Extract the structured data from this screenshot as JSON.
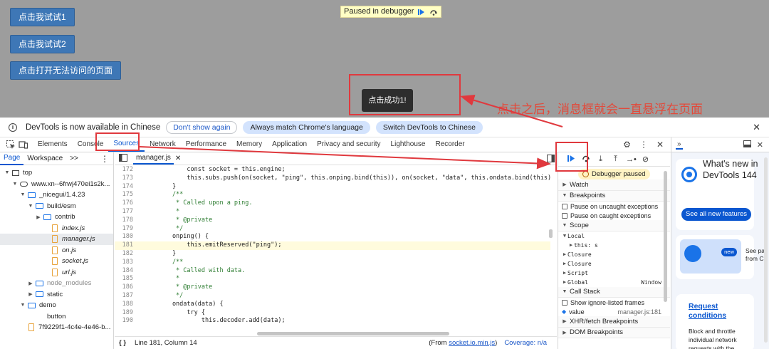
{
  "page": {
    "buttons": [
      "点击我试试1",
      "点击我试试2",
      "点击打开无法访问的页面"
    ],
    "paused_banner": "Paused in debugger",
    "toast": "点击成功1!",
    "annotation": "点击之后，消息框就会一直悬浮在页面"
  },
  "infobar": {
    "message": "DevTools is now available in Chinese",
    "dont_show": "Don't show again",
    "always_match": "Always match Chrome's language",
    "switch": "Switch DevTools to Chinese"
  },
  "tabs": [
    "Elements",
    "Console",
    "Sources",
    "Network",
    "Performance",
    "Memory",
    "Application",
    "Privacy and security",
    "Lighthouse",
    "Recorder"
  ],
  "navigator": {
    "tabs": [
      "Page",
      "Workspace",
      ">>"
    ],
    "tree": [
      {
        "label": "top",
        "kind": "frame",
        "indent": 0,
        "open": true
      },
      {
        "label": "www.xn--6frwj470ei1s2k...",
        "kind": "cloud",
        "indent": 1,
        "open": true
      },
      {
        "label": "_nicegui/1.4.23",
        "kind": "folder",
        "indent": 2,
        "open": true
      },
      {
        "label": "build/esm",
        "kind": "folder",
        "indent": 3,
        "open": true
      },
      {
        "label": "contrib",
        "kind": "folder",
        "indent": 4,
        "open": false
      },
      {
        "label": "index.js",
        "kind": "file",
        "indent": 5
      },
      {
        "label": "manager.js",
        "kind": "file",
        "indent": 5,
        "selected": true
      },
      {
        "label": "on.js",
        "kind": "file",
        "indent": 5
      },
      {
        "label": "socket.js",
        "kind": "file",
        "indent": 5
      },
      {
        "label": "url.js",
        "kind": "file",
        "indent": 5
      },
      {
        "label": "node_modules",
        "kind": "folder",
        "indent": 3,
        "open": false,
        "muted": true
      },
      {
        "label": "static",
        "kind": "folder",
        "indent": 3,
        "open": false
      },
      {
        "label": "demo",
        "kind": "folder",
        "indent": 2,
        "open": true
      },
      {
        "label": "button",
        "kind": "none",
        "indent": 4
      },
      {
        "label": "7f9229f1-4c4e-4e46-b...",
        "kind": "file",
        "indent": 2
      }
    ]
  },
  "editor": {
    "tab": "manager.js",
    "lines": [
      {
        "n": "172",
        "t": "            const socket = this.engine;",
        "c": false
      },
      {
        "n": "173",
        "t": "            this.subs.push(on(socket, \"ping\", this.onping.bind(this)), on(socket, \"data\", this.ondata.bind(this)), on(socket, \"er",
        "c": false
      },
      {
        "n": "174",
        "t": "        }",
        "c": false
      },
      {
        "n": "175",
        "t": "        /**",
        "c": true
      },
      {
        "n": "176",
        "t": "         * Called upon a ping.",
        "c": true
      },
      {
        "n": "177",
        "t": "         *",
        "c": true
      },
      {
        "n": "178",
        "t": "         * @private",
        "c": true
      },
      {
        "n": "179",
        "t": "         */",
        "c": true
      },
      {
        "n": "180",
        "t": "        onping() {",
        "c": false
      },
      {
        "n": "181",
        "t": "            this.emitReserved(\"ping\");",
        "c": false,
        "hl": true
      },
      {
        "n": "182",
        "t": "        }",
        "c": false
      },
      {
        "n": "183",
        "t": "        /**",
        "c": true
      },
      {
        "n": "184",
        "t": "         * Called with data.",
        "c": true
      },
      {
        "n": "185",
        "t": "         *",
        "c": true
      },
      {
        "n": "186",
        "t": "         * @private",
        "c": true
      },
      {
        "n": "187",
        "t": "         */",
        "c": true
      },
      {
        "n": "188",
        "t": "        ondata(data) {",
        "c": false
      },
      {
        "n": "189",
        "t": "            try {",
        "c": false
      },
      {
        "n": "190",
        "t": "                this.decoder.add(data);",
        "c": false
      }
    ],
    "status_position": "Line 181, Column 14",
    "status_from": "(From socket.io.min.js)",
    "status_from_link": "socket.io.min.js",
    "coverage": "Coverage: n/a"
  },
  "debugger": {
    "paused": "Debugger paused",
    "watch": "Watch",
    "breakpoints": "Breakpoints",
    "pause_uncaught": "Pause on uncaught exceptions",
    "pause_caught": "Pause on caught exceptions",
    "scope": "Scope",
    "local": "Local",
    "this_val": "this: s",
    "closure1": "Closure",
    "closure2": "Closure",
    "script": "Script",
    "global": "Global",
    "global_val": "Window",
    "call_stack": "Call Stack",
    "show_ignore": "Show ignore-listed frames",
    "frame_name": "value",
    "frame_loc": "manager.js:181",
    "xhr": "XHR/fetch Breakpoints",
    "dom": "DOM Breakpoints"
  },
  "whatsnew": {
    "title": "What's new in DevTools 144",
    "see_all": "See all new features",
    "new_badge": "new",
    "side_text1": "See pa",
    "side_text2": "from C",
    "link": "Request conditions",
    "desc": "Block and throttle individual network requests with the"
  },
  "colors": {
    "accent": "#0b57d0",
    "annotation": "#e0393e",
    "page_button": "#3e77b6"
  }
}
